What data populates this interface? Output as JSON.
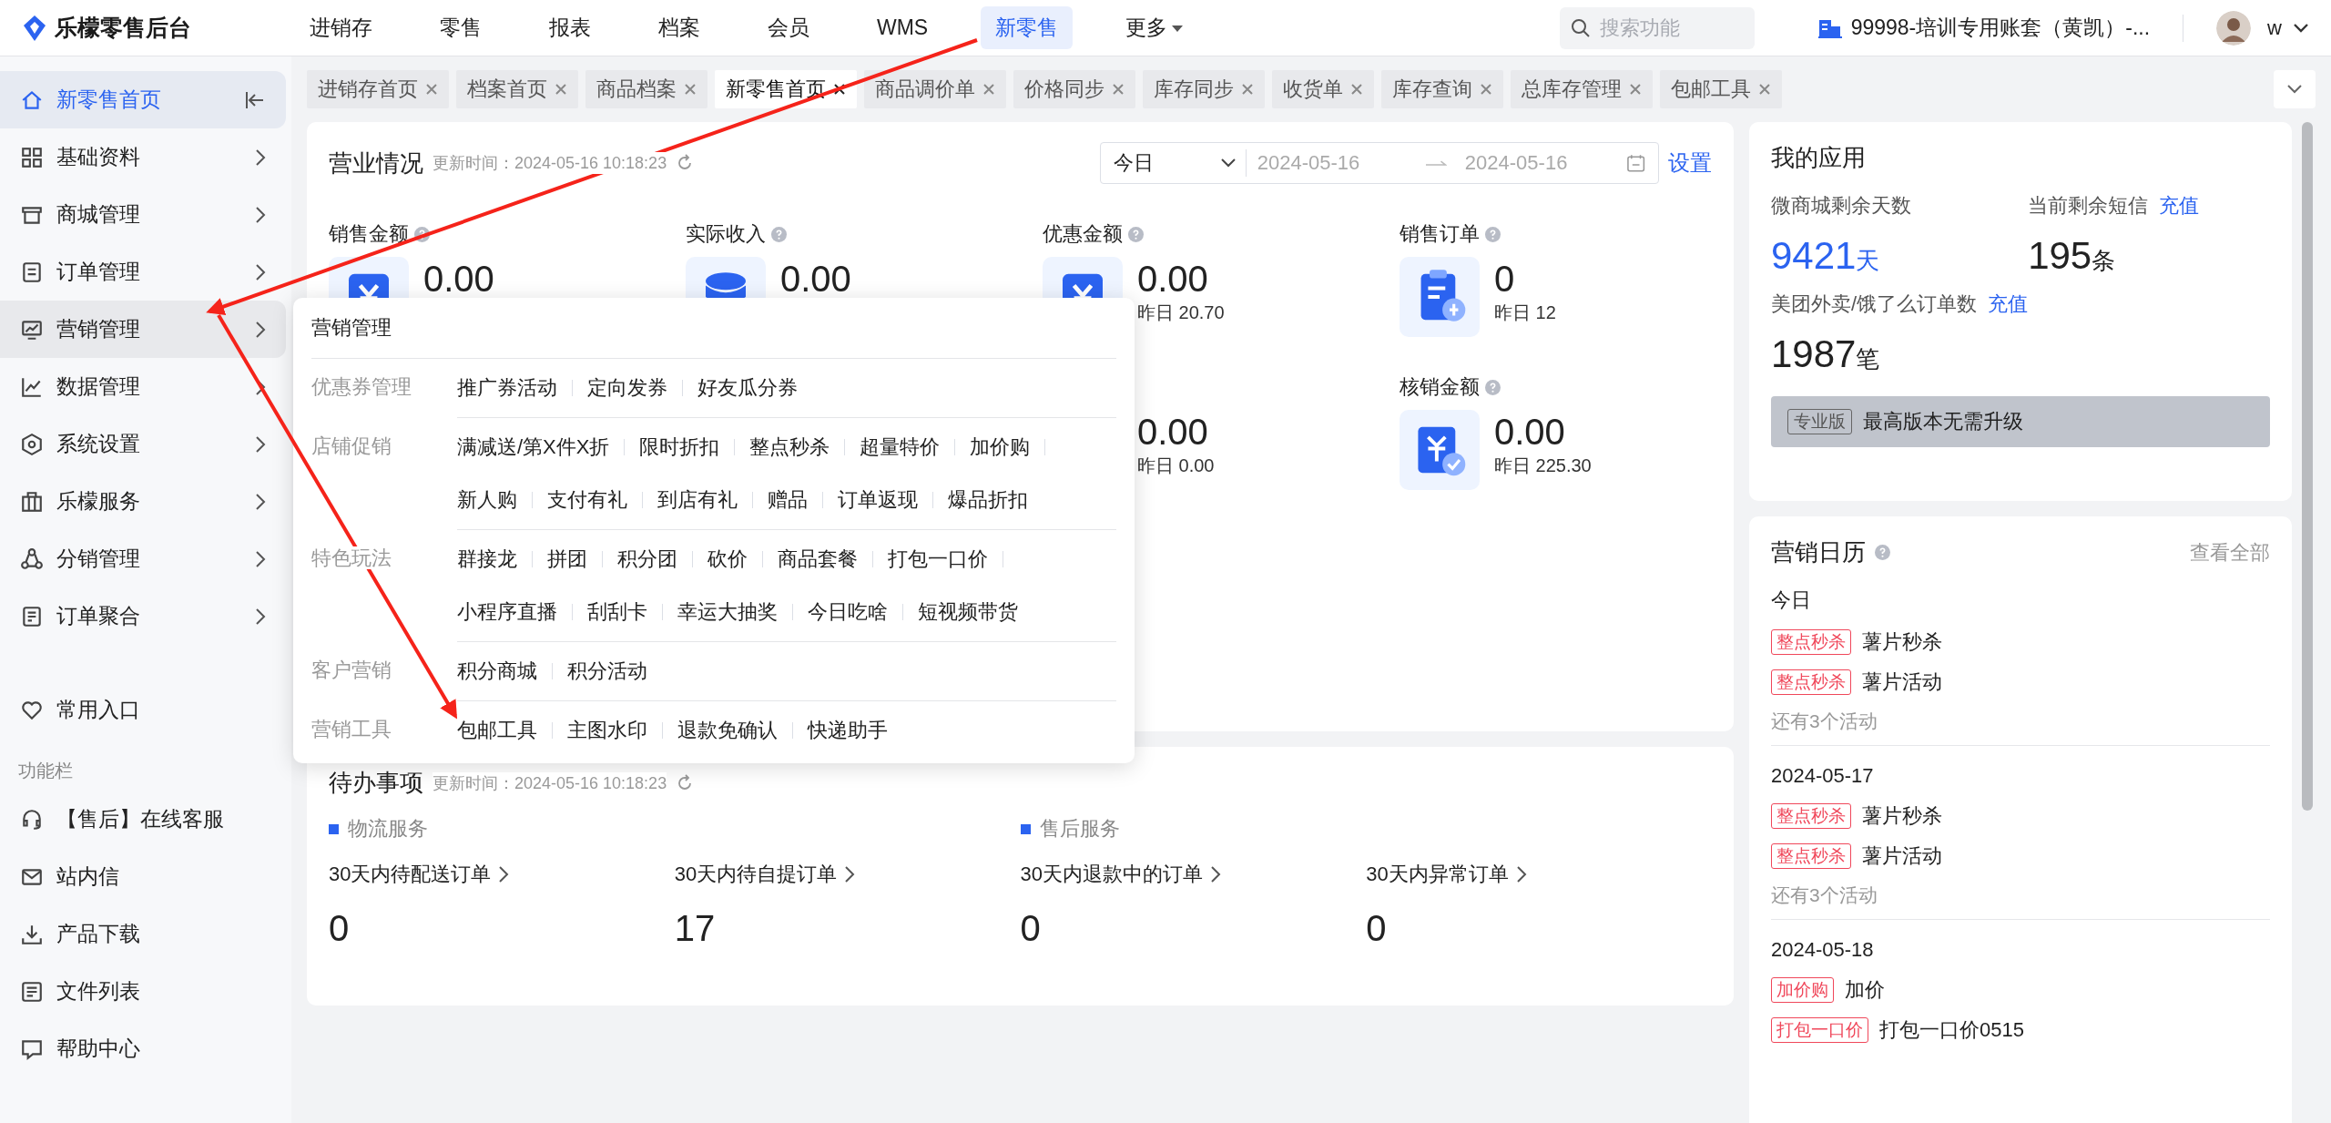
{
  "app": {
    "logo_text": "乐檬零售后台"
  },
  "nav": [
    {
      "label": "进销存",
      "selected": false,
      "kind": "link"
    },
    {
      "label": "零售",
      "selected": false,
      "kind": "link"
    },
    {
      "label": "报表",
      "selected": false,
      "kind": "link"
    },
    {
      "label": "档案",
      "selected": false,
      "kind": "link"
    },
    {
      "label": "会员",
      "selected": false,
      "kind": "link"
    },
    {
      "label": "WMS",
      "selected": false,
      "kind": "link"
    },
    {
      "label": "新零售",
      "selected": true,
      "kind": "link"
    },
    {
      "label": "更多",
      "selected": false,
      "kind": "dropdown"
    }
  ],
  "search": {
    "placeholder": "搜索功能"
  },
  "account": {
    "name": "99998-培训专用账套（黄凯）-...",
    "user": "w"
  },
  "sidebar": {
    "items": [
      {
        "label": "新零售首页",
        "selected": true,
        "open": false
      },
      {
        "label": "基础资料",
        "selected": false,
        "open": false
      },
      {
        "label": "商城管理",
        "selected": false,
        "open": false
      },
      {
        "label": "订单管理",
        "selected": false,
        "open": false
      },
      {
        "label": "营销管理",
        "selected": false,
        "open": true
      },
      {
        "label": "数据管理",
        "selected": false,
        "open": false
      },
      {
        "label": "系统设置",
        "selected": false,
        "open": false
      },
      {
        "label": "乐檬服务",
        "selected": false,
        "open": false
      },
      {
        "label": "分销管理",
        "selected": false,
        "open": false
      },
      {
        "label": "订单聚合",
        "selected": false,
        "open": false
      }
    ],
    "favorites": "常用入口",
    "section_title": "功能栏",
    "tools": [
      "【售后】在线客服",
      "站内信",
      "产品下载",
      "文件列表",
      "帮助中心"
    ]
  },
  "tabs": [
    {
      "label": "进销存首页",
      "selected": false
    },
    {
      "label": "档案首页",
      "selected": false
    },
    {
      "label": "商品档案",
      "selected": false
    },
    {
      "label": "新零售首页",
      "selected": true
    },
    {
      "label": "商品调价单",
      "selected": false
    },
    {
      "label": "价格同步",
      "selected": false
    },
    {
      "label": "库存同步",
      "selected": false
    },
    {
      "label": "收货单",
      "selected": false
    },
    {
      "label": "库存查询",
      "selected": false
    },
    {
      "label": "总库存管理",
      "selected": false
    },
    {
      "label": "包邮工具",
      "selected": false
    }
  ],
  "business": {
    "title": "营业情况",
    "updated": "更新时间：2024-05-16 10:18:23",
    "period": "今日",
    "date_from": "2024-05-16",
    "date_to": "2024-05-16",
    "settings": "设置",
    "metrics": [
      {
        "label": "销售金额",
        "value": "0.00"
      },
      {
        "label": "实际收入",
        "value": "0.00"
      },
      {
        "label": "优惠金额",
        "value": "0.00",
        "yesterday": "昨日 20.70"
      },
      {
        "label": "销售订单",
        "value": "0",
        "yesterday": "昨日 12"
      },
      {
        "value": "0.00",
        "yesterday": "昨日 0.00"
      },
      {
        "label": "核销金额",
        "value": "0.00",
        "yesterday": "昨日 225.30"
      }
    ]
  },
  "todo": {
    "title": "待办事项",
    "updated": "更新时间：2024-05-16 10:18:23",
    "groups": [
      {
        "label": "物流服务",
        "items": [
          {
            "label": "30天内待配送订单",
            "value": "0"
          },
          {
            "label": "30天内待自提订单",
            "value": "17"
          }
        ]
      },
      {
        "label": "售后服务",
        "items": [
          {
            "label": "30天内退款中的订单",
            "value": "0"
          },
          {
            "label": "30天内异常订单",
            "value": "0"
          }
        ]
      }
    ]
  },
  "apps": {
    "title": "我的应用",
    "stats": [
      {
        "label": "微商城剩余天数",
        "value": "9421",
        "unit": "天",
        "highlight": true
      },
      {
        "label": "当前剩余短信",
        "link": "充值",
        "value": "195",
        "unit": "条",
        "highlight": false
      },
      {
        "label": "美团外卖/饿了么订单数",
        "link": "充值",
        "value": "1987",
        "unit": "笔",
        "highlight": false
      }
    ],
    "edition": {
      "badge": "专业版",
      "text": "最高版本无需升级"
    }
  },
  "calendar": {
    "title": "营销日历",
    "view_all": "查看全部",
    "days": [
      {
        "date": "今日",
        "events": [
          {
            "tag": "整点秒杀",
            "name": "薯片秒杀"
          },
          {
            "tag": "整点秒杀",
            "name": "薯片活动"
          }
        ],
        "more": "还有3个活动"
      },
      {
        "date": "2024-05-17",
        "events": [
          {
            "tag": "整点秒杀",
            "name": "薯片秒杀"
          },
          {
            "tag": "整点秒杀",
            "name": "薯片活动"
          }
        ],
        "more": "还有3个活动"
      },
      {
        "date": "2024-05-18",
        "events": [
          {
            "tag": "加价购",
            "name": "加价"
          },
          {
            "tag": "打包一口价",
            "name": "打包一口价0515"
          }
        ]
      }
    ]
  },
  "flyout": {
    "title": "营销管理",
    "groups": [
      {
        "label": "优惠券管理",
        "rows": [
          {
            "links": [
              "推广券活动",
              "定向发券",
              "好友瓜分券"
            ]
          }
        ]
      },
      {
        "label": "店铺促销",
        "rows": [
          {
            "links": [
              "满减送/第X件X折",
              "限时折扣",
              "整点秒杀",
              "超量特价",
              "加价购"
            ]
          },
          {
            "links": [
              "新人购",
              "支付有礼",
              "到店有礼",
              "赠品",
              "订单返现",
              "爆品折扣"
            ]
          }
        ]
      },
      {
        "label": "特色玩法",
        "rows": [
          {
            "links": [
              "群接龙",
              "拼团",
              "积分团",
              "砍价",
              "商品套餐",
              "打包一口价"
            ]
          },
          {
            "links": [
              "小程序直播",
              "刮刮卡",
              "幸运大抽奖",
              "今日吃啥",
              "短视频带货"
            ]
          }
        ]
      },
      {
        "label": "客户营销",
        "rows": [
          {
            "links": [
              "积分商城",
              "积分活动"
            ]
          }
        ]
      },
      {
        "label": "营销工具",
        "rows": [
          {
            "links": [
              "包邮工具",
              "主图水印",
              "退款免确认",
              "快递助手"
            ]
          }
        ]
      }
    ]
  },
  "annotations": [
    {
      "kind": "arrow"
    },
    {
      "kind": "arrow"
    }
  ]
}
